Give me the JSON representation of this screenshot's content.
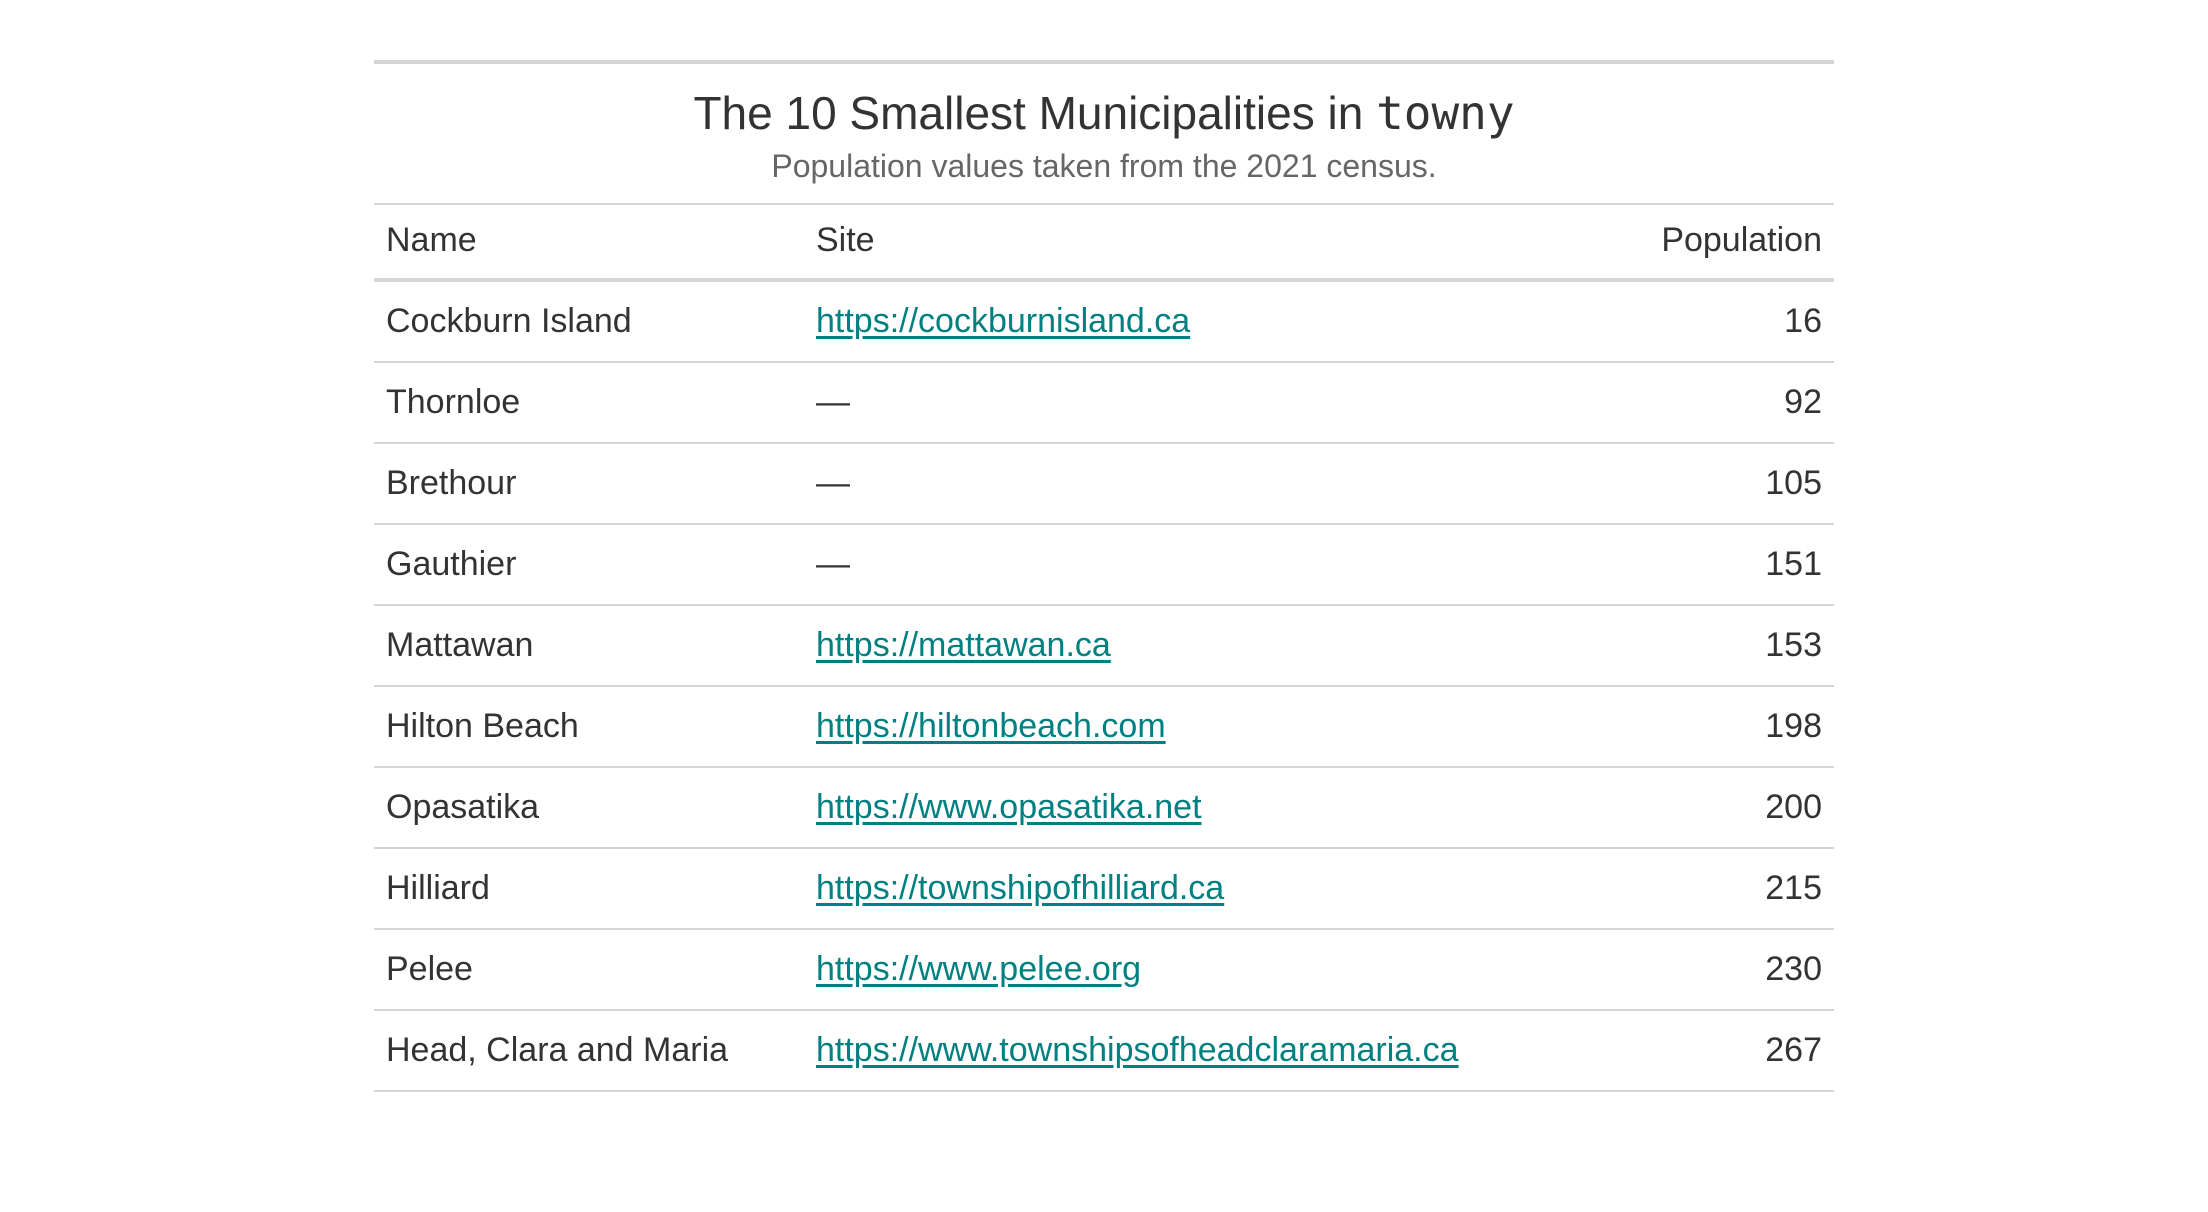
{
  "header": {
    "title_prefix": "The 10 Smallest Municipalities in ",
    "title_code": "towny",
    "subtitle": "Population values taken from the 2021 census."
  },
  "columns": {
    "name": "Name",
    "site": "Site",
    "population": "Population"
  },
  "missing_marker": "—",
  "rows": [
    {
      "name": "Cockburn Island",
      "site": "https://cockburnisland.ca",
      "population": "16"
    },
    {
      "name": "Thornloe",
      "site": null,
      "population": "92"
    },
    {
      "name": "Brethour",
      "site": null,
      "population": "105"
    },
    {
      "name": "Gauthier",
      "site": null,
      "population": "151"
    },
    {
      "name": "Mattawan",
      "site": "https://mattawan.ca",
      "population": "153"
    },
    {
      "name": "Hilton Beach",
      "site": "https://hiltonbeach.com",
      "population": "198"
    },
    {
      "name": "Opasatika",
      "site": "https://www.opasatika.net",
      "population": "200"
    },
    {
      "name": "Hilliard",
      "site": "https://townshipofhilliard.ca",
      "population": "215"
    },
    {
      "name": "Pelee",
      "site": "https://www.pelee.org",
      "population": "230"
    },
    {
      "name": "Head, Clara and Maria",
      "site": "https://www.townshipsofheadclaramaria.ca",
      "population": "267"
    }
  ]
}
